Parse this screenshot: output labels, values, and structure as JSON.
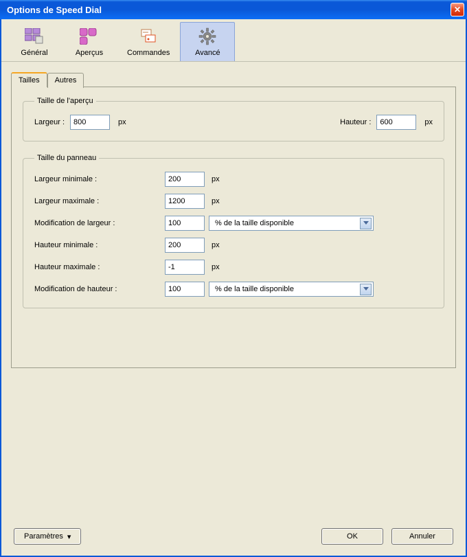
{
  "window": {
    "title": "Options de Speed Dial"
  },
  "toolbar": {
    "items": [
      {
        "label": "Général",
        "icon": "grid-icon"
      },
      {
        "label": "Aperçus",
        "icon": "preview-icon"
      },
      {
        "label": "Commandes",
        "icon": "commands-icon"
      },
      {
        "label": "Avancé",
        "icon": "gear-icon"
      }
    ],
    "active_index": 3
  },
  "tabs": {
    "items": [
      {
        "label": "Tailles"
      },
      {
        "label": "Autres"
      }
    ],
    "active_index": 0
  },
  "preview_size": {
    "legend": "Taille de l'aperçu",
    "width_label": "Largeur :",
    "width_value": "800",
    "height_label": "Hauteur :",
    "height_value": "600",
    "unit": "px"
  },
  "panel_size": {
    "legend": "Taille du panneau",
    "unit": "px",
    "rows": {
      "min_width": {
        "label": "Largeur minimale :",
        "value": "200"
      },
      "max_width": {
        "label": "Largeur maximale :",
        "value": "1200"
      },
      "width_mod": {
        "label": "Modification de largeur :",
        "value": "100",
        "select": "% de la taille disponible"
      },
      "min_height": {
        "label": "Hauteur minimale :",
        "value": "200"
      },
      "max_height": {
        "label": "Hauteur maximale :",
        "value": "-1"
      },
      "height_mod": {
        "label": "Modification de hauteur :",
        "value": "100",
        "select": "% de la taille disponible"
      }
    }
  },
  "footer": {
    "params_label": "Paramètres",
    "ok_label": "OK",
    "cancel_label": "Annuler"
  }
}
